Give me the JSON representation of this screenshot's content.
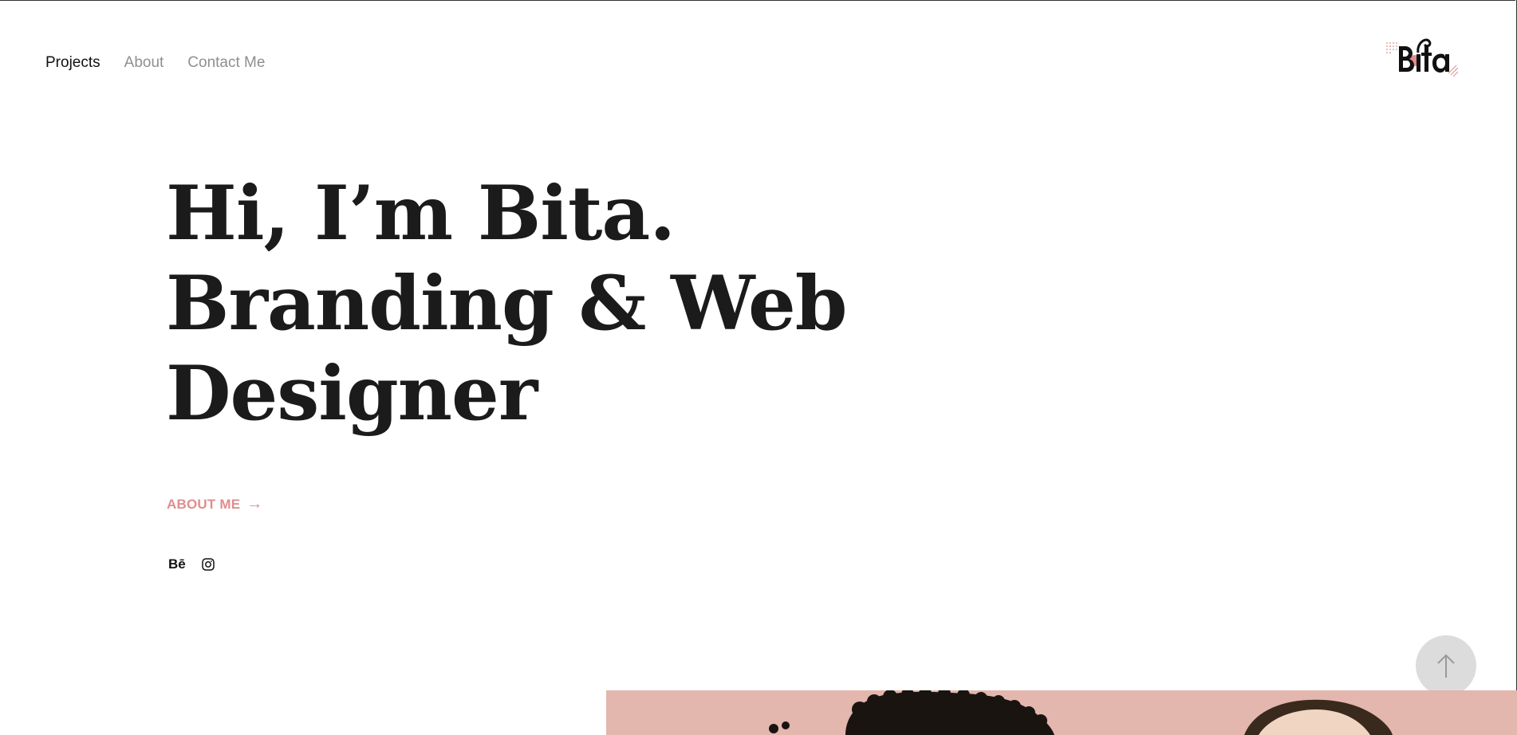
{
  "nav": {
    "items": [
      {
        "label": "Projects",
        "active": true
      },
      {
        "label": "About",
        "active": false
      },
      {
        "label": "Contact Me",
        "active": false
      }
    ]
  },
  "logo": {
    "text": "Bita",
    "accent": "#e08d8d"
  },
  "hero": {
    "line1": "Hi, I’m Bita.",
    "line2": "Branding & Web",
    "line3": "Designer"
  },
  "about_link": {
    "label": "ABOUT ME",
    "arrow": "→"
  },
  "social": {
    "behance_label": "Bē",
    "icons": [
      "behance-icon",
      "instagram-icon"
    ]
  },
  "scroll_top": {
    "icon": "arrow-up-icon"
  },
  "colors": {
    "accent": "#e08d8d",
    "text": "#1b1b1b",
    "muted": "#8f8f8f",
    "photo_bg": "#e3b6ae"
  }
}
